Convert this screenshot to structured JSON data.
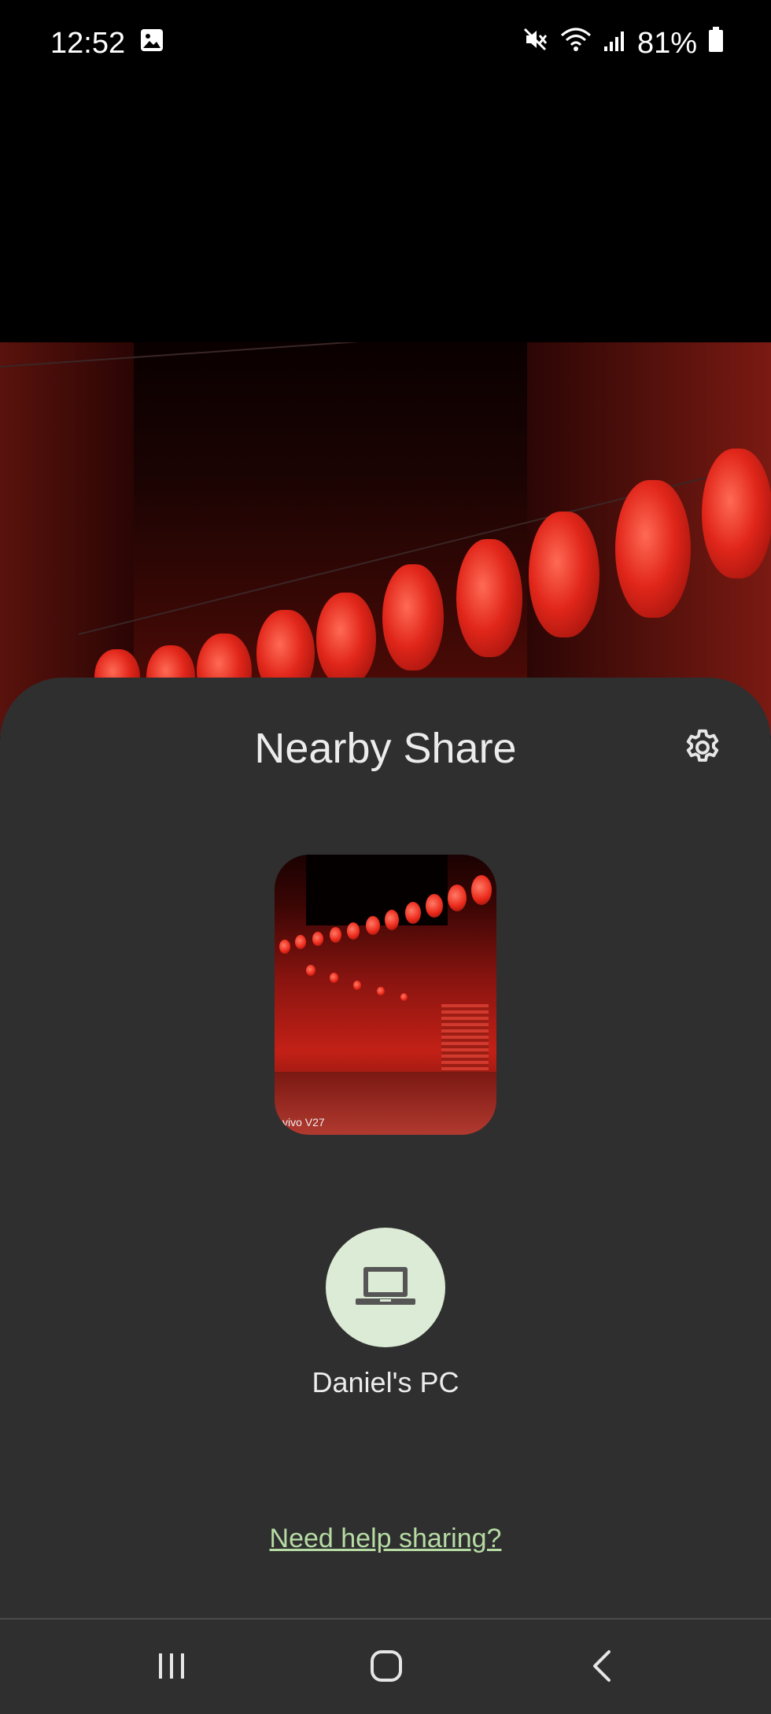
{
  "status_bar": {
    "time": "12:52",
    "battery_percent": "81%",
    "icons": [
      "gallery-notification-icon",
      "mute-icon",
      "wifi-icon",
      "signal-icon",
      "battery-icon"
    ]
  },
  "sheet": {
    "title": "Nearby Share",
    "settings_icon": "gear-icon",
    "preview_watermark": "vivo V27",
    "device": {
      "name": "Daniel's PC",
      "icon": "laptop-icon"
    },
    "help_link": "Need help sharing?"
  },
  "nav_bar": {
    "icons": [
      "recent-apps-icon",
      "home-icon",
      "back-icon"
    ]
  },
  "colors": {
    "sheet_bg": "#2f2f2f",
    "device_circle": "#dcebd5",
    "link": "#b6dca4"
  }
}
